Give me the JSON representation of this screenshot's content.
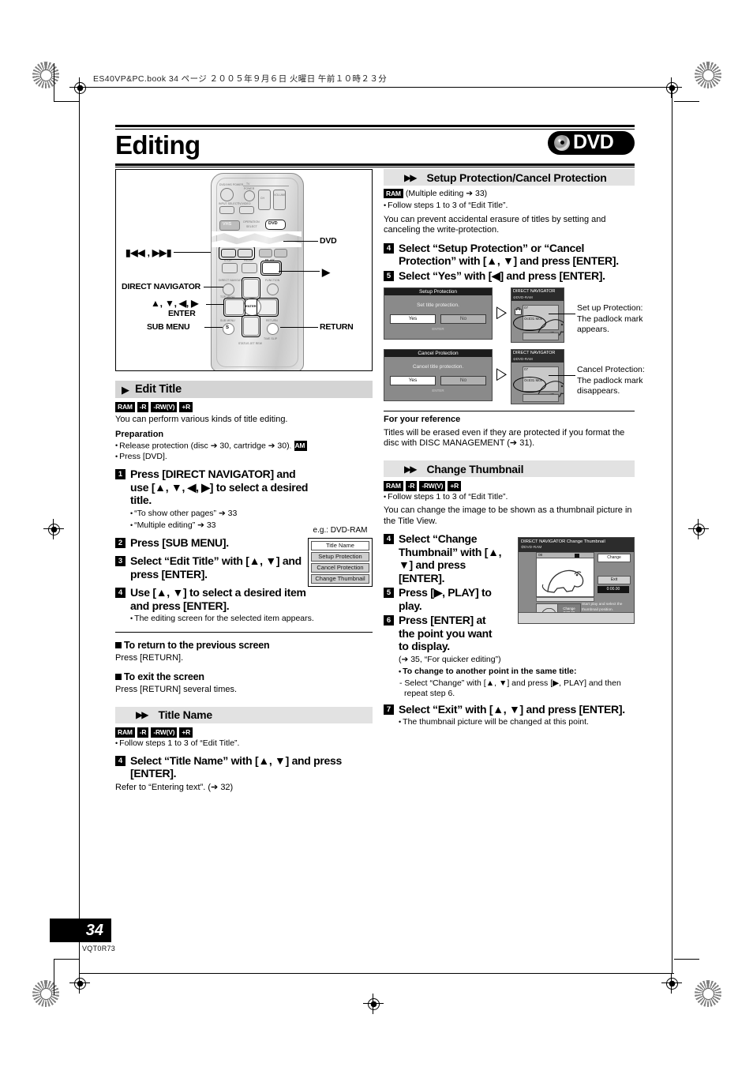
{
  "meta": {
    "file_header": "ES40VP&PC.book   34 ページ   ２００５年９月６日   火曜日   午前１０時２３分",
    "page_number": "34",
    "page_code": "VQT0R73"
  },
  "header": {
    "title": "Editing",
    "badge_label": "DVD",
    "badge_icon": "dvd-disc-icon"
  },
  "remote_figure": {
    "callouts": {
      "dvd": "DVD",
      "skip": "▮◀◀ , ▶▶▮",
      "play": "▶",
      "direct_navigator": "DIRECT NAVIGATOR",
      "cursor": "▲, ▼, ◀, ▶",
      "enter": "ENTER",
      "sub_menu": "SUB MENU",
      "return": "RETURN"
    },
    "remote_labels": {
      "power": "DVD/VHS POWER",
      "tv": "TV",
      "tv_power": "POWER",
      "input_select": "INPUT SELECT",
      "tv_video": "TV/VIDEO",
      "ch": "CH",
      "volume": "VOLUME",
      "vhs": "VHS",
      "operation_select": "OPERATION SELECT",
      "dvd_btn": "DVD",
      "skip_index": "SKIP INDEX",
      "rew_ff": "REW       FF",
      "stop": "STOP",
      "pause": "PAUSE",
      "play": "PLAY",
      "direct_navigator": "DIRECT NAVIGATOR",
      "top_menu": "TOP MENU",
      "function": "FUNCTION",
      "enter": "ENTER",
      "sub_menu": "SUB MENU",
      "sub_menu_key": "S",
      "return": "RETURN",
      "time_slip": "TIME SLIP",
      "status": "STATUS  JET REW"
    }
  },
  "edit_title": {
    "heading": "Edit Title",
    "heading_arrow": "▶",
    "badges": [
      "RAM",
      "-R",
      "-RW(V)",
      "+R"
    ],
    "intro": "You can perform various kinds of title editing.",
    "preparation_label": "Preparation",
    "prep_bullets": [
      "Release protection (disc ➔ 30, cartridge ➔ 30).",
      "Press [DVD]."
    ],
    "prep_badge": "RAM",
    "steps": [
      {
        "num": "1",
        "text": "Press [DIRECT NAVIGATOR] and use [▲, ▼, ◀, ▶] to select a desired title.",
        "subs": [
          "“To show other pages” ➔ 33",
          "“Multiple editing” ➔ 33"
        ]
      },
      {
        "num": "2",
        "text": "Press [SUB MENU].",
        "subs": []
      },
      {
        "num": "3",
        "text": "Select “Edit Title” with [▲, ▼] and press [ENTER].",
        "subs": []
      },
      {
        "num": "4",
        "text": "Use [▲, ▼] to select a desired item and press [ENTER].",
        "subs": [
          "The editing screen for the selected item appears."
        ]
      }
    ],
    "example": {
      "label": "e.g.: DVD-RAM",
      "menu_items": [
        "Title Name",
        "Setup Protection",
        "Cancel Protection",
        "Change Thumbnail"
      ]
    },
    "return_heading": "To return to the previous screen",
    "return_text": "Press [RETURN].",
    "exit_heading": "To exit the screen",
    "exit_text": "Press [RETURN] several times."
  },
  "title_name": {
    "heading": "Title Name",
    "heading_arrow": "▶▶",
    "badges": [
      "RAM",
      "-R",
      "-RW(V)",
      "+R"
    ],
    "bullet": "Follow steps 1 to 3 of “Edit Title”.",
    "step": {
      "num": "4",
      "text": "Select “Title Name” with [▲, ▼] and press [ENTER]."
    },
    "refer": "Refer to “Entering text”. (➔ 32)"
  },
  "setup_protection": {
    "heading": "Setup Protection/Cancel Protection",
    "heading_arrow": "▶▶",
    "badge": "RAM",
    "badge_note": "(Multiple editing ➔ 33)",
    "bullet": "Follow steps 1 to 3 of “Edit Title”.",
    "body": "You can prevent accidental erasure of titles by setting and canceling the write-protection.",
    "steps": [
      {
        "num": "4",
        "text": "Select “Setup Protection” or “Cancel Protection” with [▲, ▼] and press [ENTER]."
      },
      {
        "num": "5",
        "text": "Select “Yes” with [◀] and press [ENTER]."
      }
    ],
    "screens": [
      {
        "title": "Setup Protection",
        "message": "Set title protection.",
        "yes": "Yes",
        "no": "No",
        "enter_hint": "ENTER",
        "nav_title": "DIRECT NAVIGATOR",
        "nav_sub": "⊘DVD-RAM",
        "cell_num": "07",
        "cell_text": "Oct/31 Mon",
        "note": "Set up Protection:\nThe padlock mark appears."
      },
      {
        "title": "Cancel Protection",
        "message": "Cancel title protection.",
        "yes": "Yes",
        "no": "No",
        "enter_hint": "ENTER",
        "nav_title": "DIRECT NAVIGATOR",
        "nav_sub": "⊘DVD-RAM",
        "cell_num": "07",
        "cell_text": "Oct/31 Mon",
        "note": "Cancel Protection:\nThe padlock mark disappears."
      }
    ],
    "reference_heading": "For your reference",
    "reference_text": "Titles will be erased even if they are protected if you format the disc with DISC MANAGEMENT (➔ 31)."
  },
  "change_thumbnail": {
    "heading": "Change Thumbnail",
    "heading_arrow": "▶▶",
    "badges": [
      "RAM",
      "-R",
      "-RW(V)",
      "+R"
    ],
    "bullet": "Follow steps 1 to 3 of “Edit Title”.",
    "body": "You can change the image to be shown as a thumbnail picture in the Title View.",
    "steps": [
      {
        "num": "4",
        "text": "Select “Change Thumbnail” with [▲, ▼] and press [ENTER].",
        "subs": []
      },
      {
        "num": "5",
        "text": "Press [▶, PLAY] to play.",
        "subs": []
      },
      {
        "num": "6",
        "text": "Press [ENTER] at the point you want to display.",
        "subs": [
          "(➔ 35, “For quicker editing”)"
        ],
        "bold_sub": "To change to another point in the same title:",
        "dash_sub": "- Select “Change” with [▲, ▼] and press [▶, PLAY] and then repeat step 6."
      },
      {
        "num": "7",
        "text": "Select “Exit” with [▲, ▼] and press [ENTER].",
        "subs": [
          "The thumbnail picture will be changed at this point."
        ]
      }
    ],
    "screen": {
      "header": "DIRECT NAVIGATOR  Change Thumbnail",
      "sub": "⊘DVD-RAM",
      "chapter_num": "08",
      "change_btn": "Change",
      "exit_btn": "Exit",
      "time": "0:00.00",
      "thumb_label": "Change",
      "thumb_time": "0:00.00",
      "hint": "Start play and select the thumbnail position."
    }
  }
}
